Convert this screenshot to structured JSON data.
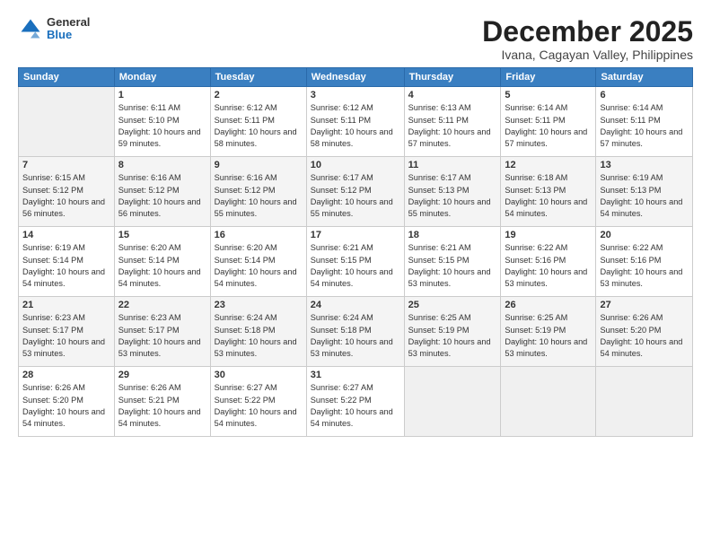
{
  "header": {
    "logo": {
      "general": "General",
      "blue": "Blue"
    },
    "title": "December 2025",
    "subtitle": "Ivana, Cagayan Valley, Philippines"
  },
  "days_of_week": [
    "Sunday",
    "Monday",
    "Tuesday",
    "Wednesday",
    "Thursday",
    "Friday",
    "Saturday"
  ],
  "weeks": [
    [
      {
        "day": "",
        "empty": true
      },
      {
        "day": "1",
        "sunrise": "6:11 AM",
        "sunset": "5:10 PM",
        "daylight": "10 hours and 59 minutes."
      },
      {
        "day": "2",
        "sunrise": "6:12 AM",
        "sunset": "5:11 PM",
        "daylight": "10 hours and 58 minutes."
      },
      {
        "day": "3",
        "sunrise": "6:12 AM",
        "sunset": "5:11 PM",
        "daylight": "10 hours and 58 minutes."
      },
      {
        "day": "4",
        "sunrise": "6:13 AM",
        "sunset": "5:11 PM",
        "daylight": "10 hours and 57 minutes."
      },
      {
        "day": "5",
        "sunrise": "6:14 AM",
        "sunset": "5:11 PM",
        "daylight": "10 hours and 57 minutes."
      },
      {
        "day": "6",
        "sunrise": "6:14 AM",
        "sunset": "5:11 PM",
        "daylight": "10 hours and 57 minutes."
      }
    ],
    [
      {
        "day": "7",
        "sunrise": "6:15 AM",
        "sunset": "5:12 PM",
        "daylight": "10 hours and 56 minutes."
      },
      {
        "day": "8",
        "sunrise": "6:16 AM",
        "sunset": "5:12 PM",
        "daylight": "10 hours and 56 minutes."
      },
      {
        "day": "9",
        "sunrise": "6:16 AM",
        "sunset": "5:12 PM",
        "daylight": "10 hours and 55 minutes."
      },
      {
        "day": "10",
        "sunrise": "6:17 AM",
        "sunset": "5:12 PM",
        "daylight": "10 hours and 55 minutes."
      },
      {
        "day": "11",
        "sunrise": "6:17 AM",
        "sunset": "5:13 PM",
        "daylight": "10 hours and 55 minutes."
      },
      {
        "day": "12",
        "sunrise": "6:18 AM",
        "sunset": "5:13 PM",
        "daylight": "10 hours and 54 minutes."
      },
      {
        "day": "13",
        "sunrise": "6:19 AM",
        "sunset": "5:13 PM",
        "daylight": "10 hours and 54 minutes."
      }
    ],
    [
      {
        "day": "14",
        "sunrise": "6:19 AM",
        "sunset": "5:14 PM",
        "daylight": "10 hours and 54 minutes."
      },
      {
        "day": "15",
        "sunrise": "6:20 AM",
        "sunset": "5:14 PM",
        "daylight": "10 hours and 54 minutes."
      },
      {
        "day": "16",
        "sunrise": "6:20 AM",
        "sunset": "5:14 PM",
        "daylight": "10 hours and 54 minutes."
      },
      {
        "day": "17",
        "sunrise": "6:21 AM",
        "sunset": "5:15 PM",
        "daylight": "10 hours and 54 minutes."
      },
      {
        "day": "18",
        "sunrise": "6:21 AM",
        "sunset": "5:15 PM",
        "daylight": "10 hours and 53 minutes."
      },
      {
        "day": "19",
        "sunrise": "6:22 AM",
        "sunset": "5:16 PM",
        "daylight": "10 hours and 53 minutes."
      },
      {
        "day": "20",
        "sunrise": "6:22 AM",
        "sunset": "5:16 PM",
        "daylight": "10 hours and 53 minutes."
      }
    ],
    [
      {
        "day": "21",
        "sunrise": "6:23 AM",
        "sunset": "5:17 PM",
        "daylight": "10 hours and 53 minutes."
      },
      {
        "day": "22",
        "sunrise": "6:23 AM",
        "sunset": "5:17 PM",
        "daylight": "10 hours and 53 minutes."
      },
      {
        "day": "23",
        "sunrise": "6:24 AM",
        "sunset": "5:18 PM",
        "daylight": "10 hours and 53 minutes."
      },
      {
        "day": "24",
        "sunrise": "6:24 AM",
        "sunset": "5:18 PM",
        "daylight": "10 hours and 53 minutes."
      },
      {
        "day": "25",
        "sunrise": "6:25 AM",
        "sunset": "5:19 PM",
        "daylight": "10 hours and 53 minutes."
      },
      {
        "day": "26",
        "sunrise": "6:25 AM",
        "sunset": "5:19 PM",
        "daylight": "10 hours and 53 minutes."
      },
      {
        "day": "27",
        "sunrise": "6:26 AM",
        "sunset": "5:20 PM",
        "daylight": "10 hours and 54 minutes."
      }
    ],
    [
      {
        "day": "28",
        "sunrise": "6:26 AM",
        "sunset": "5:20 PM",
        "daylight": "10 hours and 54 minutes."
      },
      {
        "day": "29",
        "sunrise": "6:26 AM",
        "sunset": "5:21 PM",
        "daylight": "10 hours and 54 minutes."
      },
      {
        "day": "30",
        "sunrise": "6:27 AM",
        "sunset": "5:22 PM",
        "daylight": "10 hours and 54 minutes."
      },
      {
        "day": "31",
        "sunrise": "6:27 AM",
        "sunset": "5:22 PM",
        "daylight": "10 hours and 54 minutes."
      },
      {
        "day": "",
        "empty": true
      },
      {
        "day": "",
        "empty": true
      },
      {
        "day": "",
        "empty": true
      }
    ]
  ],
  "labels": {
    "sunrise_prefix": "Sunrise: ",
    "sunset_prefix": "Sunset: ",
    "daylight_prefix": "Daylight: "
  }
}
